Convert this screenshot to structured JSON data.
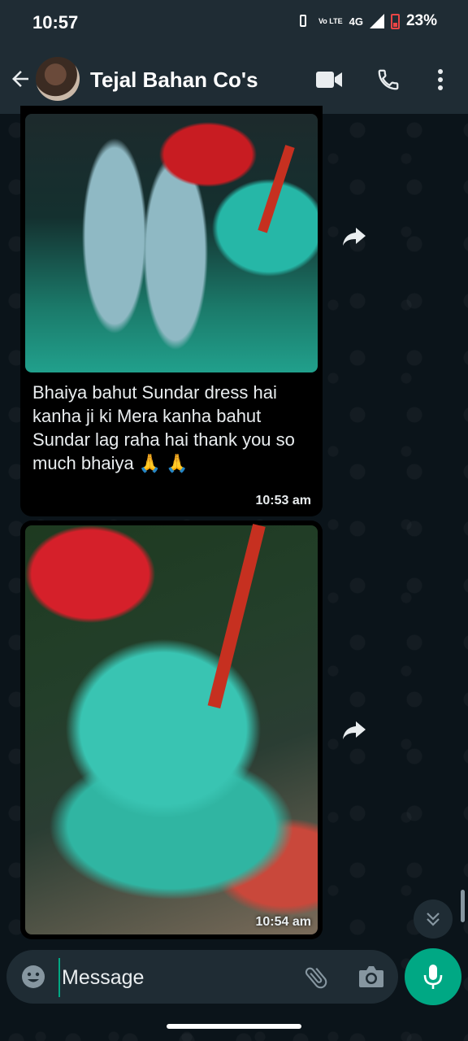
{
  "status_bar": {
    "time": "10:57",
    "volte": "Vo LTE",
    "network": "4G",
    "battery": "23%"
  },
  "header": {
    "contact_name": "Tejal Bahan Co's"
  },
  "messages": [
    {
      "type": "image_with_caption",
      "text": "Bhaiya bahut Sundar dress hai kanha ji ki Mera kanha bahut Sundar lag raha hai thank you so much bhaiya 🙏 🙏",
      "time": "10:53 am"
    },
    {
      "type": "image",
      "time": "10:54 am"
    }
  ],
  "composer": {
    "placeholder": "Message"
  },
  "colors": {
    "background": "#0b141a",
    "panel": "#1f2c34",
    "accent": "#00a884",
    "bubble": "#000000"
  },
  "icons": [
    "back-arrow-icon",
    "video-call-icon",
    "phone-icon",
    "more-vert-icon",
    "forward-icon",
    "chevron-down-icon",
    "emoji-icon",
    "attach-icon",
    "camera-icon",
    "mic-icon"
  ]
}
